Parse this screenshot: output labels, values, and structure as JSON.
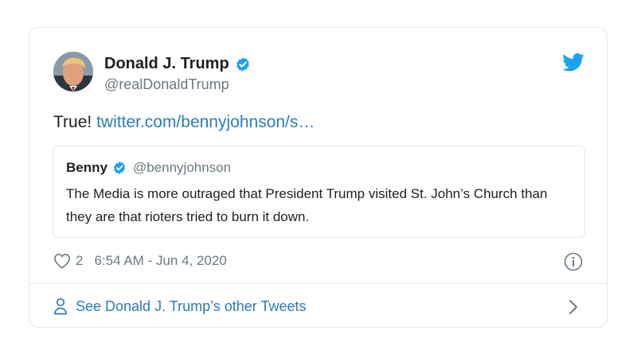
{
  "author": {
    "name": "Donald J. Trump",
    "handle": "@realDonaldTrump"
  },
  "tweet": {
    "text": "True!",
    "link": "twitter.com/bennyjohnson/s…"
  },
  "quoted": {
    "name": "Benny",
    "handle": "@bennyjohnson",
    "text": "The Media is more outraged that President Trump visited St. John’s Church than they are that rioters tried to burn it down."
  },
  "meta": {
    "likes": "2",
    "timestamp": "6:54 AM - Jun 4, 2020"
  },
  "footer": {
    "label": "See Donald J. Trump’s other Tweets"
  },
  "icons": {
    "brand": "twitter-bird-icon",
    "verified": "verified-badge-icon",
    "like": "heart-icon",
    "info": "info-icon",
    "profile": "person-icon",
    "next": "chevron-right-icon"
  },
  "colors": {
    "link": "#2b7bb9",
    "verified": "#1da1f2",
    "secondary_text": "#697882",
    "border": "#e1e8ed"
  }
}
